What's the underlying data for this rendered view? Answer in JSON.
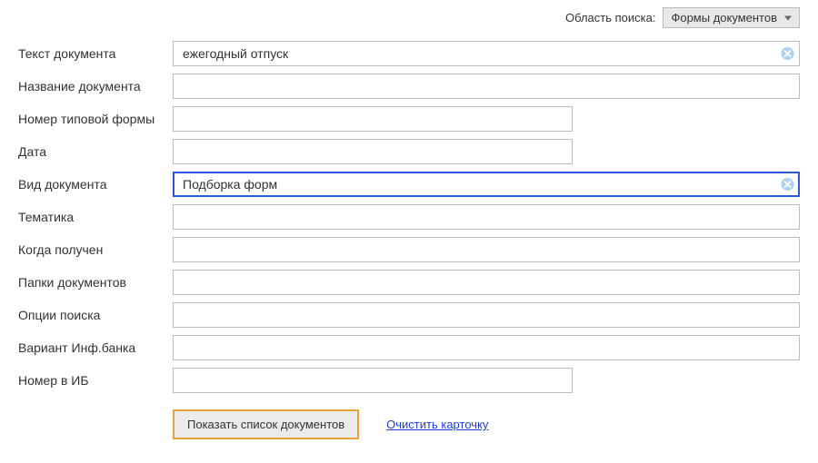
{
  "header": {
    "scope_label": "Область поиска:",
    "scope_value": "Формы документов"
  },
  "fields": {
    "text": {
      "label": "Текст документа",
      "value": "ежегодный отпуск",
      "has_clear": true,
      "width": "full"
    },
    "name": {
      "label": "Название документа",
      "value": "",
      "width": "full"
    },
    "form_number": {
      "label": "Номер типовой формы",
      "value": "",
      "width": "mid"
    },
    "date": {
      "label": "Дата",
      "value": "",
      "width": "mid"
    },
    "doc_type": {
      "label": "Вид документа",
      "value": "Подборка форм",
      "has_clear": true,
      "width": "full",
      "focused": true
    },
    "topic": {
      "label": "Тематика",
      "value": "",
      "width": "full"
    },
    "received": {
      "label": "Когда получен",
      "value": "",
      "width": "full"
    },
    "folders": {
      "label": "Папки документов",
      "value": "",
      "width": "full"
    },
    "options": {
      "label": "Опции поиска",
      "value": "",
      "width": "full"
    },
    "bank_variant": {
      "label": "Вариант Инф.банка",
      "value": "",
      "width": "full"
    },
    "ib_number": {
      "label": "Номер в ИБ",
      "value": "",
      "width": "mid"
    }
  },
  "field_order": [
    "text",
    "name",
    "form_number",
    "date",
    "doc_type",
    "topic",
    "received",
    "folders",
    "options",
    "bank_variant",
    "ib_number"
  ],
  "actions": {
    "submit": "Показать список документов",
    "clear": "Очистить карточку"
  }
}
